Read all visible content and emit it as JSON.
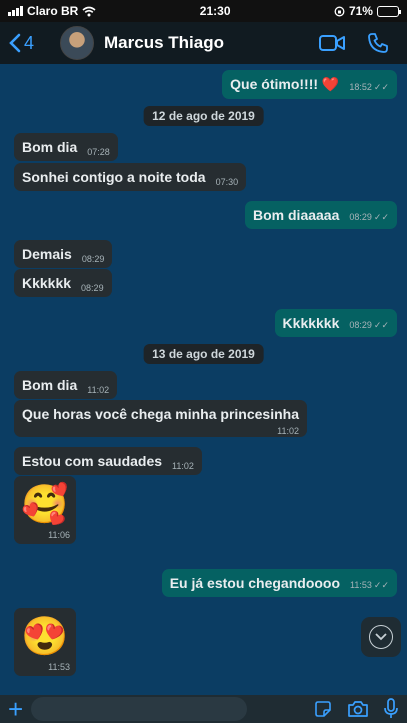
{
  "status_bar": {
    "carrier": "Claro BR",
    "time": "21:30",
    "battery": "71%",
    "battery_level": 0.71
  },
  "header": {
    "back_count": "4",
    "contact_name": "Marcus Thiago"
  },
  "messages": [
    {
      "text": "Que ótimo!!!! ❤️",
      "time": "18:52"
    },
    {
      "date": "12 de ago de 2019"
    },
    {
      "text": "Bom dia",
      "time": "07:28"
    },
    {
      "text": "Sonhei contigo a noite toda",
      "time": "07:30"
    },
    {
      "text": "Bom diaaaaa",
      "time": "08:29"
    },
    {
      "text": "Demais",
      "time": "08:29"
    },
    {
      "text": "Kkkkkk",
      "time": "08:29"
    },
    {
      "text": "Kkkkkkk",
      "time": "08:29"
    },
    {
      "date": "13 de ago de 2019"
    },
    {
      "text": "Bom dia",
      "time": "11:02"
    },
    {
      "text": "Que horas você chega minha princesinha",
      "time": "11:02"
    },
    {
      "text": "Estou com saudades",
      "time": "11:02"
    },
    {
      "text": "🥰",
      "time": "11:06"
    },
    {
      "text": "Eu já estou chegandoooo",
      "time": "11:53"
    },
    {
      "text": "😍",
      "time": "11:53"
    }
  ],
  "composer": {
    "placeholder": ""
  },
  "colors": {
    "background": "#0b3d63",
    "incoming": "#262d31",
    "outgoing": "#056162",
    "accent": "#3aa0ff"
  }
}
